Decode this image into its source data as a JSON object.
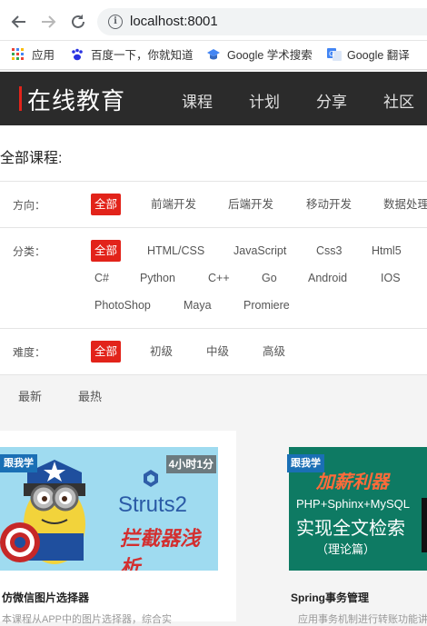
{
  "browser": {
    "url": "localhost:8001",
    "bookmarks": [
      {
        "label": "应用",
        "icon": "apps-grid-icon"
      },
      {
        "label": "百度一下，你就知道",
        "icon": "baidu-paw-icon"
      },
      {
        "label": "Google 学术搜索",
        "icon": "scholar-cap-icon"
      },
      {
        "label": "Google 翻译",
        "icon": "translate-icon"
      }
    ]
  },
  "header": {
    "logo": "在线教育",
    "menu": [
      "课程",
      "计划",
      "分享",
      "社区"
    ]
  },
  "filters": {
    "title": "全部课程:",
    "direction": {
      "label": "方向：",
      "items": [
        "全部",
        "前端开发",
        "后端开发",
        "移动开发",
        "数据处理"
      ]
    },
    "category": {
      "label": "分类：",
      "items": [
        "全部",
        "HTML/CSS",
        "JavaScript",
        "Css3",
        "Html5",
        "C#",
        "Python",
        "C++",
        "Go",
        "Android",
        "IOS",
        "PhotoShop",
        "Maya",
        "Promiere"
      ]
    },
    "difficulty": {
      "label": "难度：",
      "items": [
        "全部",
        "初级",
        "中级",
        "高级"
      ]
    }
  },
  "sort": {
    "items": [
      "最新",
      "最热"
    ]
  },
  "courses": [
    {
      "tag": "跟我学",
      "duration": "4小时1分",
      "image_title": "Struts2",
      "image_subtitle": "拦截器浅析",
      "title": "仿微信图片选择器",
      "desc": "本课程从APP中的图片选择器，综合实"
    },
    {
      "tag": "跟我学",
      "image_title": "加薪利器",
      "image_subtitle": "PHP+Sphinx+MySQL",
      "image_line3": "实现全文检索",
      "image_line4": "（理论篇）",
      "title": "Spring事务管理",
      "desc": "应用事务机制进行转账功能讲"
    }
  ],
  "colors": {
    "accent": "#e2231a",
    "header_bg": "#2b2b2b",
    "tag_blue": "#1a6fb5"
  }
}
